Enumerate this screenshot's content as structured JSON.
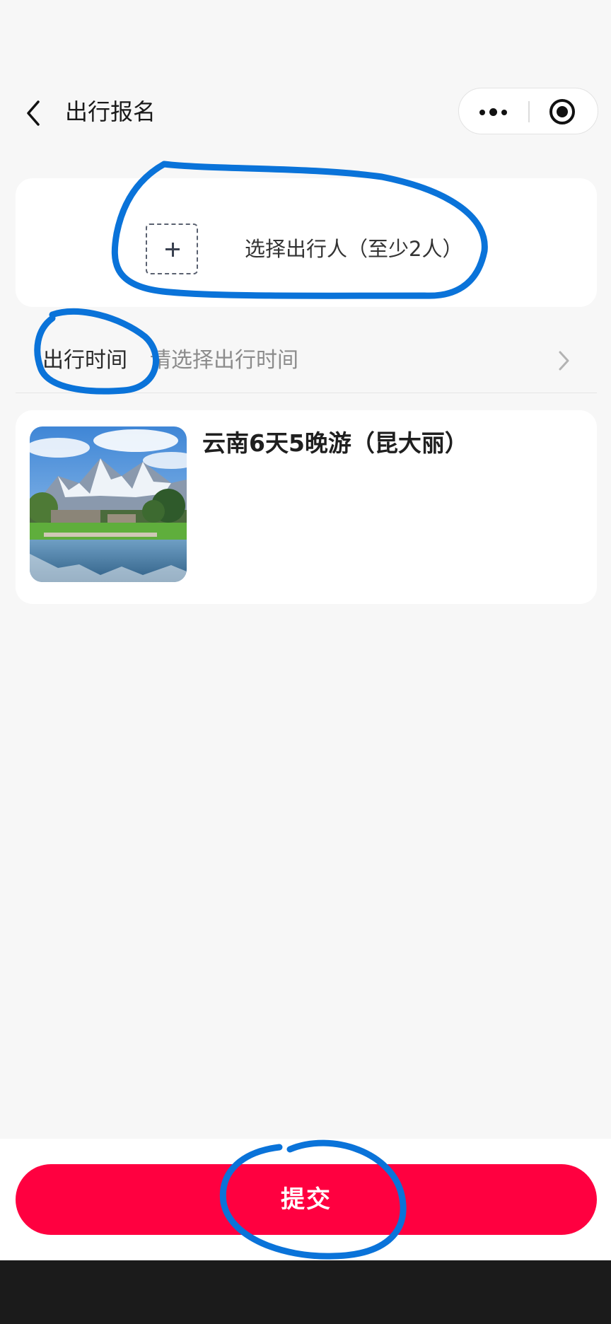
{
  "nav": {
    "title": "出行报名",
    "back_icon": "chevron-left-icon",
    "capsule": {
      "more_icon": "more-dots-icon",
      "close_icon": "target-circle-icon"
    }
  },
  "traveler": {
    "add_icon": "plus-icon",
    "label": "选择出行人（至少2人）"
  },
  "time_row": {
    "label": "出行时间",
    "placeholder": "请选择出行时间",
    "chevron_icon": "chevron-right-icon"
  },
  "product": {
    "title": "云南6天5晚游（昆大丽）",
    "image": "snow-mountain-lake-photo"
  },
  "footer": {
    "submit_label": "提交"
  },
  "colors": {
    "accent": "#ff0040",
    "background": "#f7f7f7",
    "card": "#ffffff",
    "annotation": "#0a73d9"
  }
}
